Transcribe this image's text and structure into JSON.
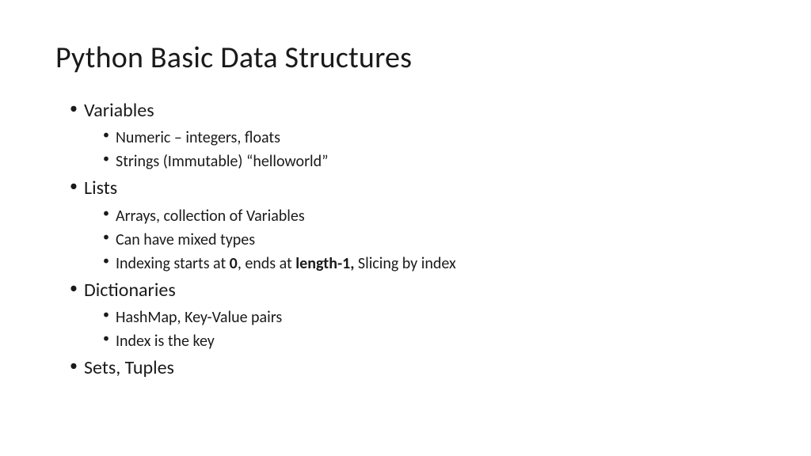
{
  "title": "Python Basic Data Structures",
  "items": [
    {
      "label": "Variables",
      "children": [
        {
          "text": "Numeric – integers, floats"
        },
        {
          "text": "Strings (Immutable) “helloworld”"
        }
      ]
    },
    {
      "label": "Lists",
      "children": [
        {
          "text": "Arrays, collection of Variables"
        },
        {
          "text": "Can have mixed types"
        },
        {
          "parts": [
            {
              "t": "Indexing starts at "
            },
            {
              "t": "0",
              "bold": true
            },
            {
              "t": ", ends at "
            },
            {
              "t": "length-1,",
              "bold": true
            },
            {
              "t": " Slicing by index"
            }
          ]
        }
      ]
    },
    {
      "label": "Dictionaries",
      "children": [
        {
          "text": "HashMap, Key-Value pairs"
        },
        {
          "text": "Index is the key"
        }
      ]
    },
    {
      "label": "Sets, Tuples",
      "children": []
    }
  ]
}
